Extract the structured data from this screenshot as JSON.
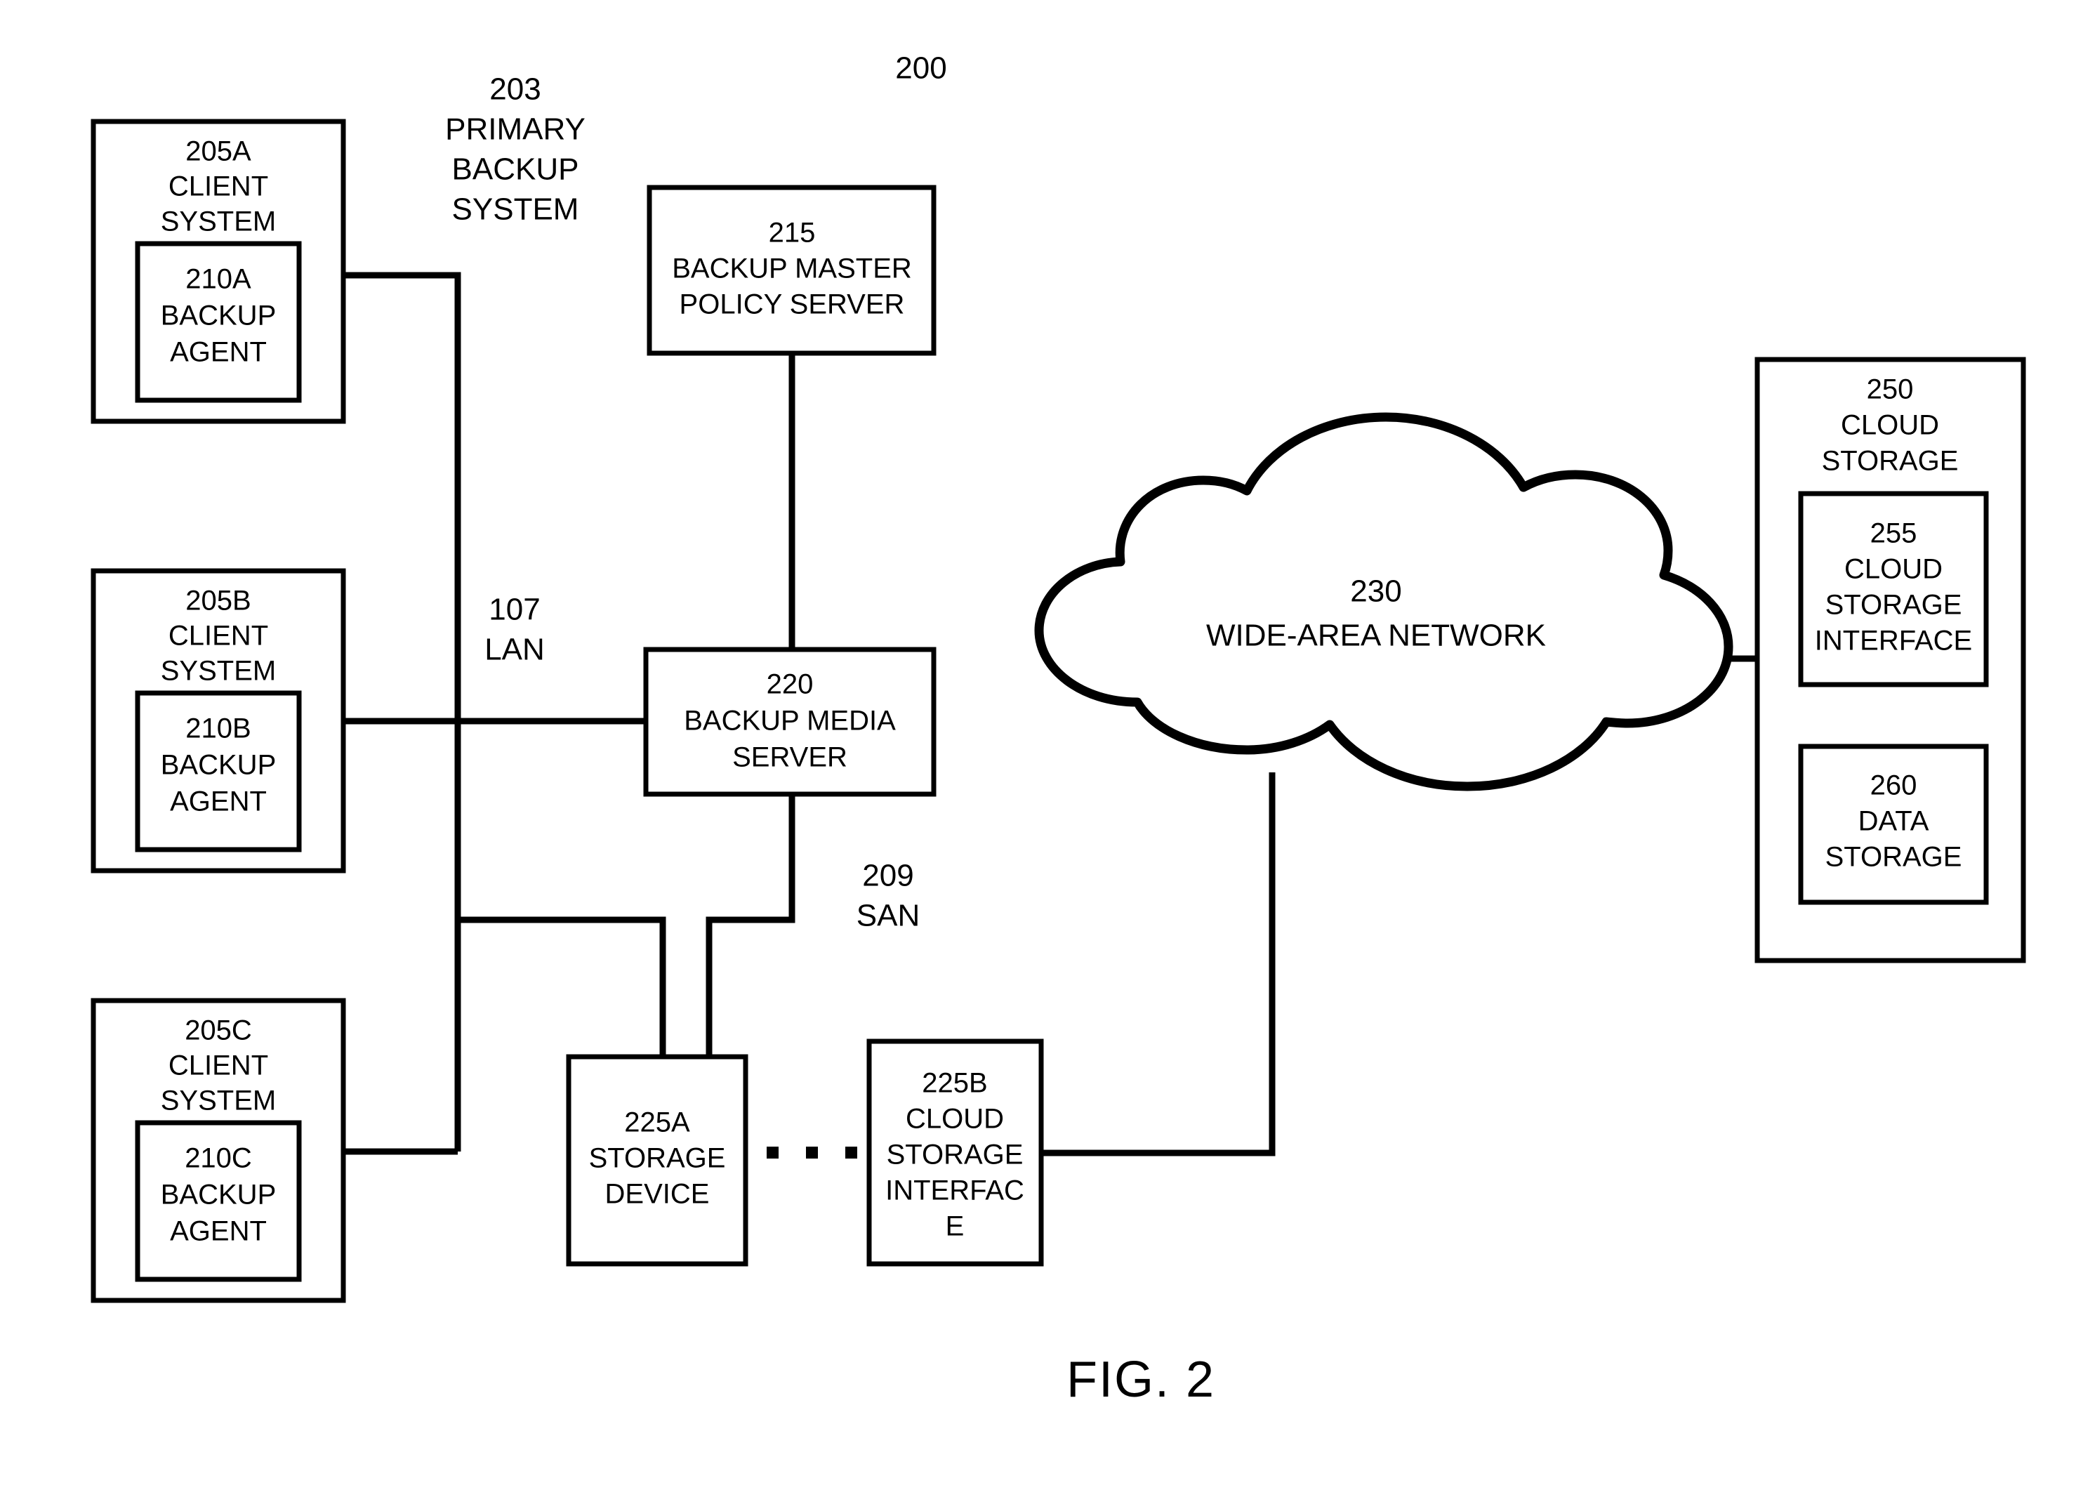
{
  "figure": {
    "caption": "FIG. 2",
    "system_number": "200"
  },
  "labels": {
    "primary_backup_system": {
      "number": "203",
      "line1": "PRIMARY",
      "line2": "BACKUP",
      "line3": "SYSTEM"
    },
    "lan": {
      "number": "107",
      "name": "LAN"
    },
    "san": {
      "number": "209",
      "name": "SAN"
    }
  },
  "nodes": {
    "client_a": {
      "number": "205A",
      "line1": "CLIENT",
      "line2": "SYSTEM",
      "agent": {
        "number": "210A",
        "line1": "BACKUP",
        "line2": "AGENT"
      }
    },
    "client_b": {
      "number": "205B",
      "line1": "CLIENT",
      "line2": "SYSTEM",
      "agent": {
        "number": "210B",
        "line1": "BACKUP",
        "line2": "AGENT"
      }
    },
    "client_c": {
      "number": "205C",
      "line1": "CLIENT",
      "line2": "SYSTEM",
      "agent": {
        "number": "210C",
        "line1": "BACKUP",
        "line2": "AGENT"
      }
    },
    "policy_server": {
      "number": "215",
      "line1": "BACKUP MASTER",
      "line2": "POLICY SERVER"
    },
    "media_server": {
      "number": "220",
      "line1": "BACKUP MEDIA",
      "line2": "SERVER"
    },
    "storage_device": {
      "number": "225A",
      "line1": "STORAGE",
      "line2": "DEVICE"
    },
    "cloud_storage_interface_225b": {
      "number": "225B",
      "line1": "CLOUD",
      "line2": "STORAGE",
      "line3": "INTERFAC",
      "line4": "E"
    },
    "wide_area_network": {
      "number": "230",
      "name": "WIDE-AREA NETWORK"
    },
    "cloud_storage": {
      "number": "250",
      "line1": "CLOUD",
      "line2": "STORAGE",
      "interface": {
        "number": "255",
        "line1": "CLOUD",
        "line2": "STORAGE",
        "line3": "INTERFACE"
      },
      "data_storage": {
        "number": "260",
        "line1": "DATA",
        "line2": "STORAGE"
      }
    }
  },
  "colors": {
    "stroke": "#000000",
    "background": "#ffffff"
  }
}
